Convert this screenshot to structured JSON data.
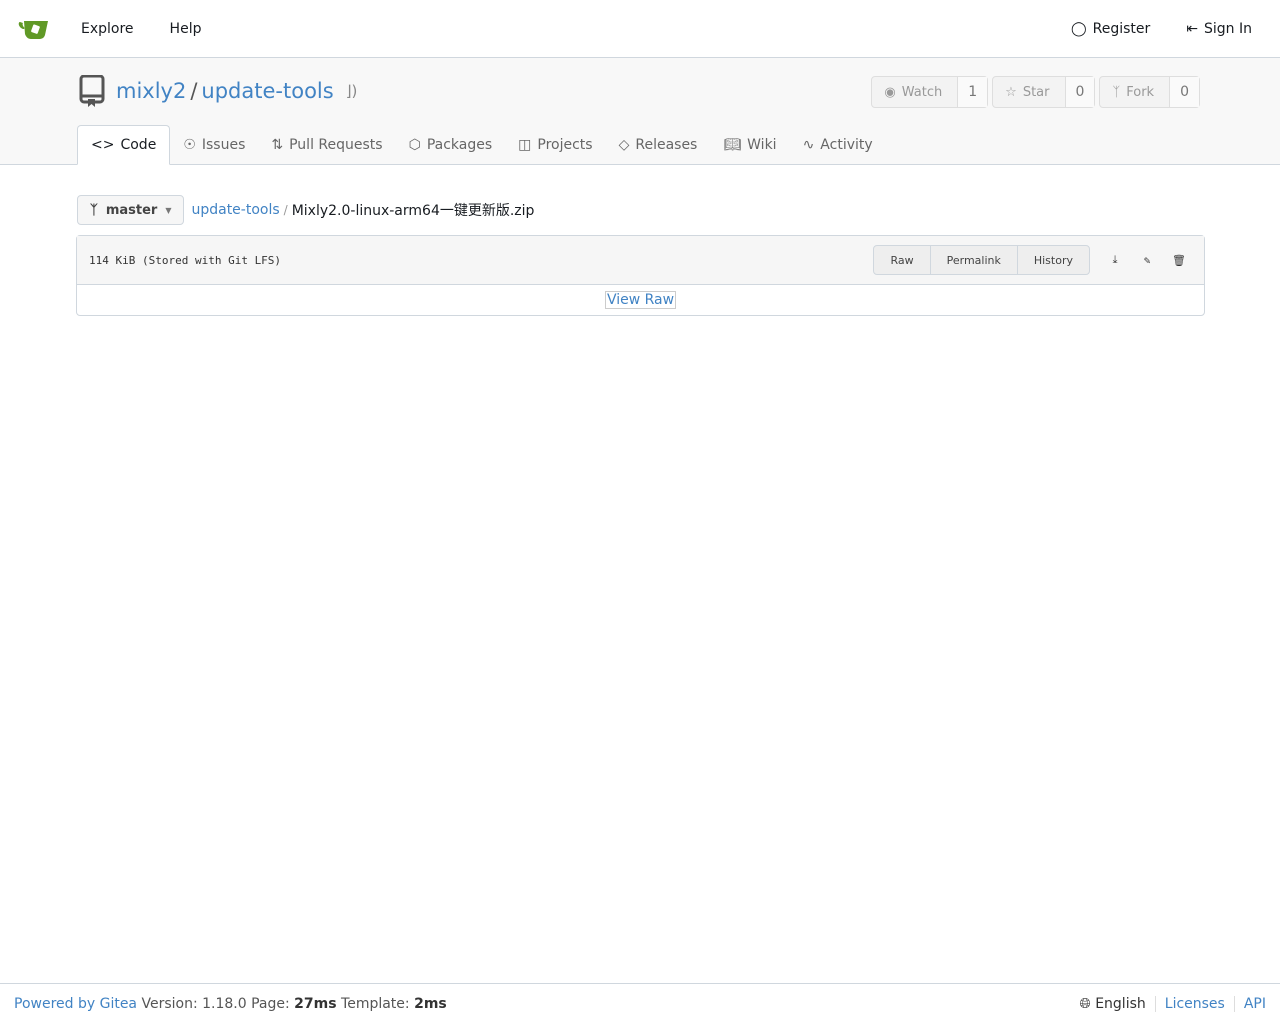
{
  "nav": {
    "explore": "Explore",
    "help": "Help",
    "register": "Register",
    "sign_in": "Sign In",
    "brand_color": "#609926"
  },
  "repo": {
    "owner": "mixly2",
    "name": "update-tools",
    "watch": "Watch",
    "watch_count": "1",
    "star": "Star",
    "star_count": "0",
    "fork": "Fork",
    "fork_count": "0"
  },
  "tabs": [
    "Code",
    "Issues",
    "Pull Requests",
    "Packages",
    "Projects",
    "Releases",
    "Wiki",
    "Activity"
  ],
  "crumb": {
    "branch": "master",
    "root": "update-tools",
    "sep": "/",
    "file": "Mixly2.0-linux-arm64一键更新版.zip"
  },
  "file": {
    "size": "114 KiB (Stored with Git LFS)",
    "raw": "Raw",
    "permalink": "Permalink",
    "history": "History",
    "view_raw": "View Raw"
  },
  "footer": {
    "powered": "Powered by Gitea",
    "version_label": "Version:",
    "version": "1.18.0",
    "page_label": "Page:",
    "page_time": "27ms",
    "template_label": "Template:",
    "template_time": "2ms",
    "language": "English",
    "licenses": "Licenses",
    "api": "API"
  }
}
